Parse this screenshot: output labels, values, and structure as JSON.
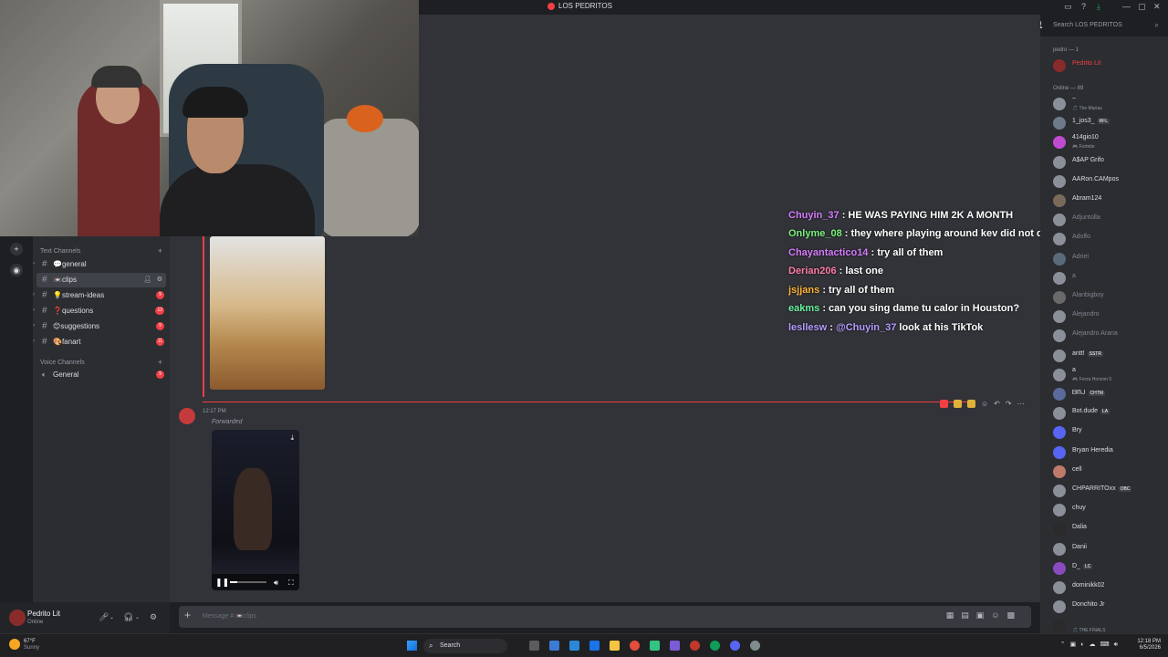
{
  "window": {
    "title": "LOS PEDRITOS"
  },
  "search": {
    "placeholder": "Search LOS PEDRITOS"
  },
  "sidebar": {
    "text_category": "Text Channels",
    "voice_category": "Voice Channels",
    "channels": [
      {
        "name": "💬general",
        "badge": ""
      },
      {
        "name": "📼clips",
        "badge": ""
      },
      {
        "name": "💡stream-ideas",
        "badge": "9"
      },
      {
        "name": "❓questions",
        "badge": "12"
      },
      {
        "name": "😊suggestions",
        "badge": "9"
      },
      {
        "name": "🎨fanart",
        "badge": "11"
      }
    ],
    "voice_channels": [
      {
        "name": "General",
        "badge": "9"
      }
    ]
  },
  "user": {
    "name": "Pedrito Lit",
    "status": "Online"
  },
  "message": {
    "meta": "12:17 PM",
    "forwarded": "Forwarded"
  },
  "composer": {
    "placeholder": "Message # 📼clips"
  },
  "overlay_chat": [
    {
      "user": "Chuyin_37",
      "color": "#d77cff",
      "text": ": HE WAS PAYING HIM 2K A MONTH",
      "mention": ""
    },
    {
      "user": "Onlyme_08",
      "color": "#7cf27c",
      "text": ": they where playing around kev did not quit oblivion said it on live",
      "mention": ""
    },
    {
      "user": "Chayantactico14",
      "color": "#d77cff",
      "text": ": try all of them",
      "mention": ""
    },
    {
      "user": "Derian206",
      "color": "#ff7ca6",
      "text": ": last one",
      "mention": ""
    },
    {
      "user": "jsjjans",
      "color": "#ffb43a",
      "text": ": try all of them",
      "mention": ""
    },
    {
      "user": "eakms",
      "color": "#6cf2a0",
      "text": ": can you sing dame tu calor in Houston?",
      "mention": ""
    },
    {
      "user": "lesllesw",
      "color": "#b59cff",
      "text": "look at his TikTok",
      "mention": "@Chuyin_37"
    }
  ],
  "members": {
    "owner_header": "pedro — 1",
    "owner": {
      "name": "Pedrito Lit",
      "color": "#f23f43"
    },
    "online_header": "Online — 89",
    "list": [
      {
        "name": "~",
        "sub": "🎵 The Marías",
        "tag": "",
        "color": "#8a8f99"
      },
      {
        "name": "1_jos3_",
        "sub": "",
        "tag": "RFL",
        "color": "#6d7a8a"
      },
      {
        "name": "414gio10",
        "sub": "🎮 Fortnite",
        "tag": "",
        "color": "#c04bd1"
      },
      {
        "name": "A$AP Grifo",
        "sub": "",
        "tag": "",
        "color": "#8a8f99"
      },
      {
        "name": "AARon.CAMpos",
        "sub": "",
        "tag": "",
        "color": "#8a8f99"
      },
      {
        "name": "Abram124",
        "sub": "",
        "tag": "",
        "color": "#7a6a5a"
      },
      {
        "name": "Adjuntolla",
        "sub": "",
        "tag": "",
        "color": "#8a8f99"
      },
      {
        "name": "Adolfo",
        "sub": "",
        "tag": "",
        "color": "#8a8f99"
      },
      {
        "name": "Adriel",
        "sub": "",
        "tag": "",
        "color": "#5a6a7a"
      },
      {
        "name": "a",
        "sub": "",
        "tag": "",
        "color": "#8a8f99"
      },
      {
        "name": "Alanbigboy",
        "sub": "",
        "tag": "",
        "color": "#6a6a6a"
      },
      {
        "name": "Alejandro",
        "sub": "",
        "tag": "",
        "color": "#8a8f99"
      },
      {
        "name": "Alejandro Arana",
        "sub": "",
        "tag": "",
        "color": "#8a8f99"
      },
      {
        "name": "antt!",
        "sub": "",
        "tag": "SSTR",
        "color": "#8a8f99"
      },
      {
        "name": "a",
        "sub": "🎮 Forza Horizon 5",
        "tag": "",
        "color": "#8a8f99"
      },
      {
        "name": "ᗷᗰᒍ",
        "sub": "",
        "tag": "CHTM",
        "color": "#5a6a9a"
      },
      {
        "name": "Bot.dude",
        "sub": "",
        "tag": "LA",
        "color": "#8a8f99"
      },
      {
        "name": "Bry",
        "sub": "",
        "tag": "",
        "color": "#5865f2"
      },
      {
        "name": "Bryan Heredia",
        "sub": "",
        "tag": "",
        "color": "#5865f2"
      },
      {
        "name": "cell",
        "sub": "",
        "tag": "",
        "color": "#c07a6a"
      },
      {
        "name": "CHPARRITOxx",
        "sub": "",
        "tag": "OBC",
        "color": "#8a8f99"
      },
      {
        "name": "chuy",
        "sub": "",
        "tag": "",
        "color": "#8a8f99"
      },
      {
        "name": "Dalia",
        "sub": "",
        "tag": "",
        "color": "#2a2a2a"
      },
      {
        "name": "Danii",
        "sub": "",
        "tag": "",
        "color": "#8a8f99"
      },
      {
        "name": "D_",
        "sub": "",
        "tag": "LC",
        "color": "#8a4ac0"
      },
      {
        "name": "dominikk02",
        "sub": "",
        "tag": "",
        "color": "#8a8f99"
      },
      {
        "name": "Donchito Jr",
        "sub": "",
        "tag": "",
        "color": "#8a8f99"
      },
      {
        "name": "",
        "sub": "🎵 THE FINALS",
        "tag": "",
        "color": "#2a2a2a"
      }
    ]
  },
  "taskbar": {
    "weather_temp": "67°F",
    "weather_desc": "Sunny",
    "search_label": "Search",
    "time": "12:18 PM",
    "date": "6/5/2026"
  }
}
